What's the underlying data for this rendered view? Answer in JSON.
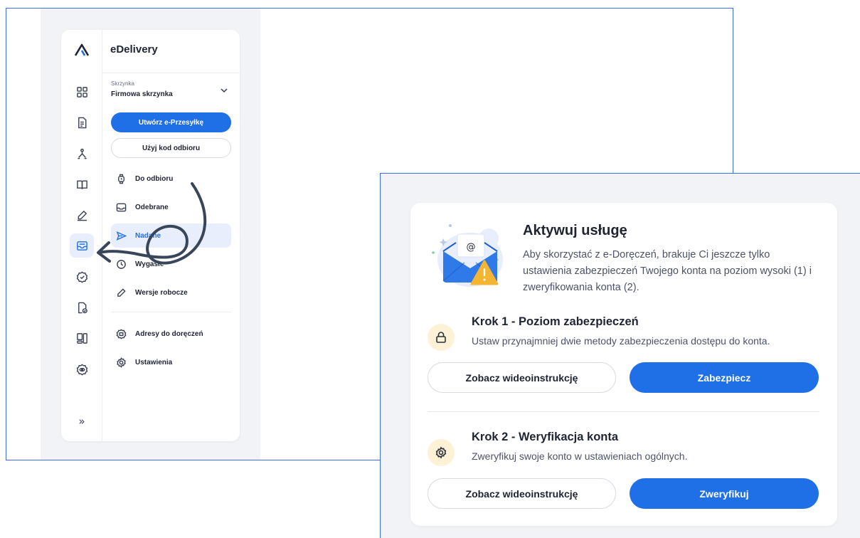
{
  "app": {
    "name": "eDelivery"
  },
  "sidebar": {
    "mailbox_caption": "Skrzynka",
    "mailbox_name": "Firmowa skrzynka",
    "create_button": "Utwórz e-Przesyłkę",
    "pickup_code_button": "Użyj kod odbioru",
    "items": [
      {
        "label": "Do odbioru",
        "icon": "watch-icon"
      },
      {
        "label": "Odebrane",
        "icon": "inbox-icon"
      },
      {
        "label": "Nadane",
        "icon": "send-icon"
      },
      {
        "label": "Wygasłe",
        "icon": "clock-icon"
      },
      {
        "label": "Wersje robocze",
        "icon": "pencil-icon"
      }
    ],
    "bottom_items": [
      {
        "label": "Adresy do doręczeń",
        "icon": "address-icon"
      },
      {
        "label": "Ustawienia",
        "icon": "gear-icon"
      }
    ],
    "active_item": "Nadane",
    "rail_icons": [
      "dashboard-icon",
      "document-icon",
      "routes-icon",
      "book-icon",
      "pen-icon",
      "mailbox-icon",
      "badge-icon",
      "file-check-icon",
      "layout-icon",
      "eye-settings-icon",
      "expand-icon"
    ],
    "expand_glyph": "»"
  },
  "activation": {
    "title": "Aktywuj usługę",
    "description": "Aby skorzystać z e-Doręczeń, brakuje Ci jeszcze tylko ustawienia  zabezpieczeń Twojego konta na poziom wysoki (1) i zweryfikowania konta (2).",
    "steps": [
      {
        "title": "Krok 1 - Poziom zabezpieczeń",
        "description": "Ustaw przynajmniej dwie metody zabezpieczenia dostępu do konta.",
        "secondary_button": "Zobacz wideoinstrukcję",
        "primary_button": "Zabezpiecz",
        "icon": "lock-icon"
      },
      {
        "title": "Krok 2 - Weryfikacja konta",
        "description": "Zweryfikuj swoje konto w ustawieniach ogólnych.",
        "secondary_button": "Zobacz wideoinstrukcję",
        "primary_button": "Zweryfikuj",
        "icon": "gear-icon"
      }
    ]
  },
  "colors": {
    "accent": "#1f6fe6",
    "frame_border": "#3b6ee6",
    "badge_bg": "#fdf2d5",
    "warning": "#f4b533",
    "annotation_arrow": "#39465a"
  }
}
